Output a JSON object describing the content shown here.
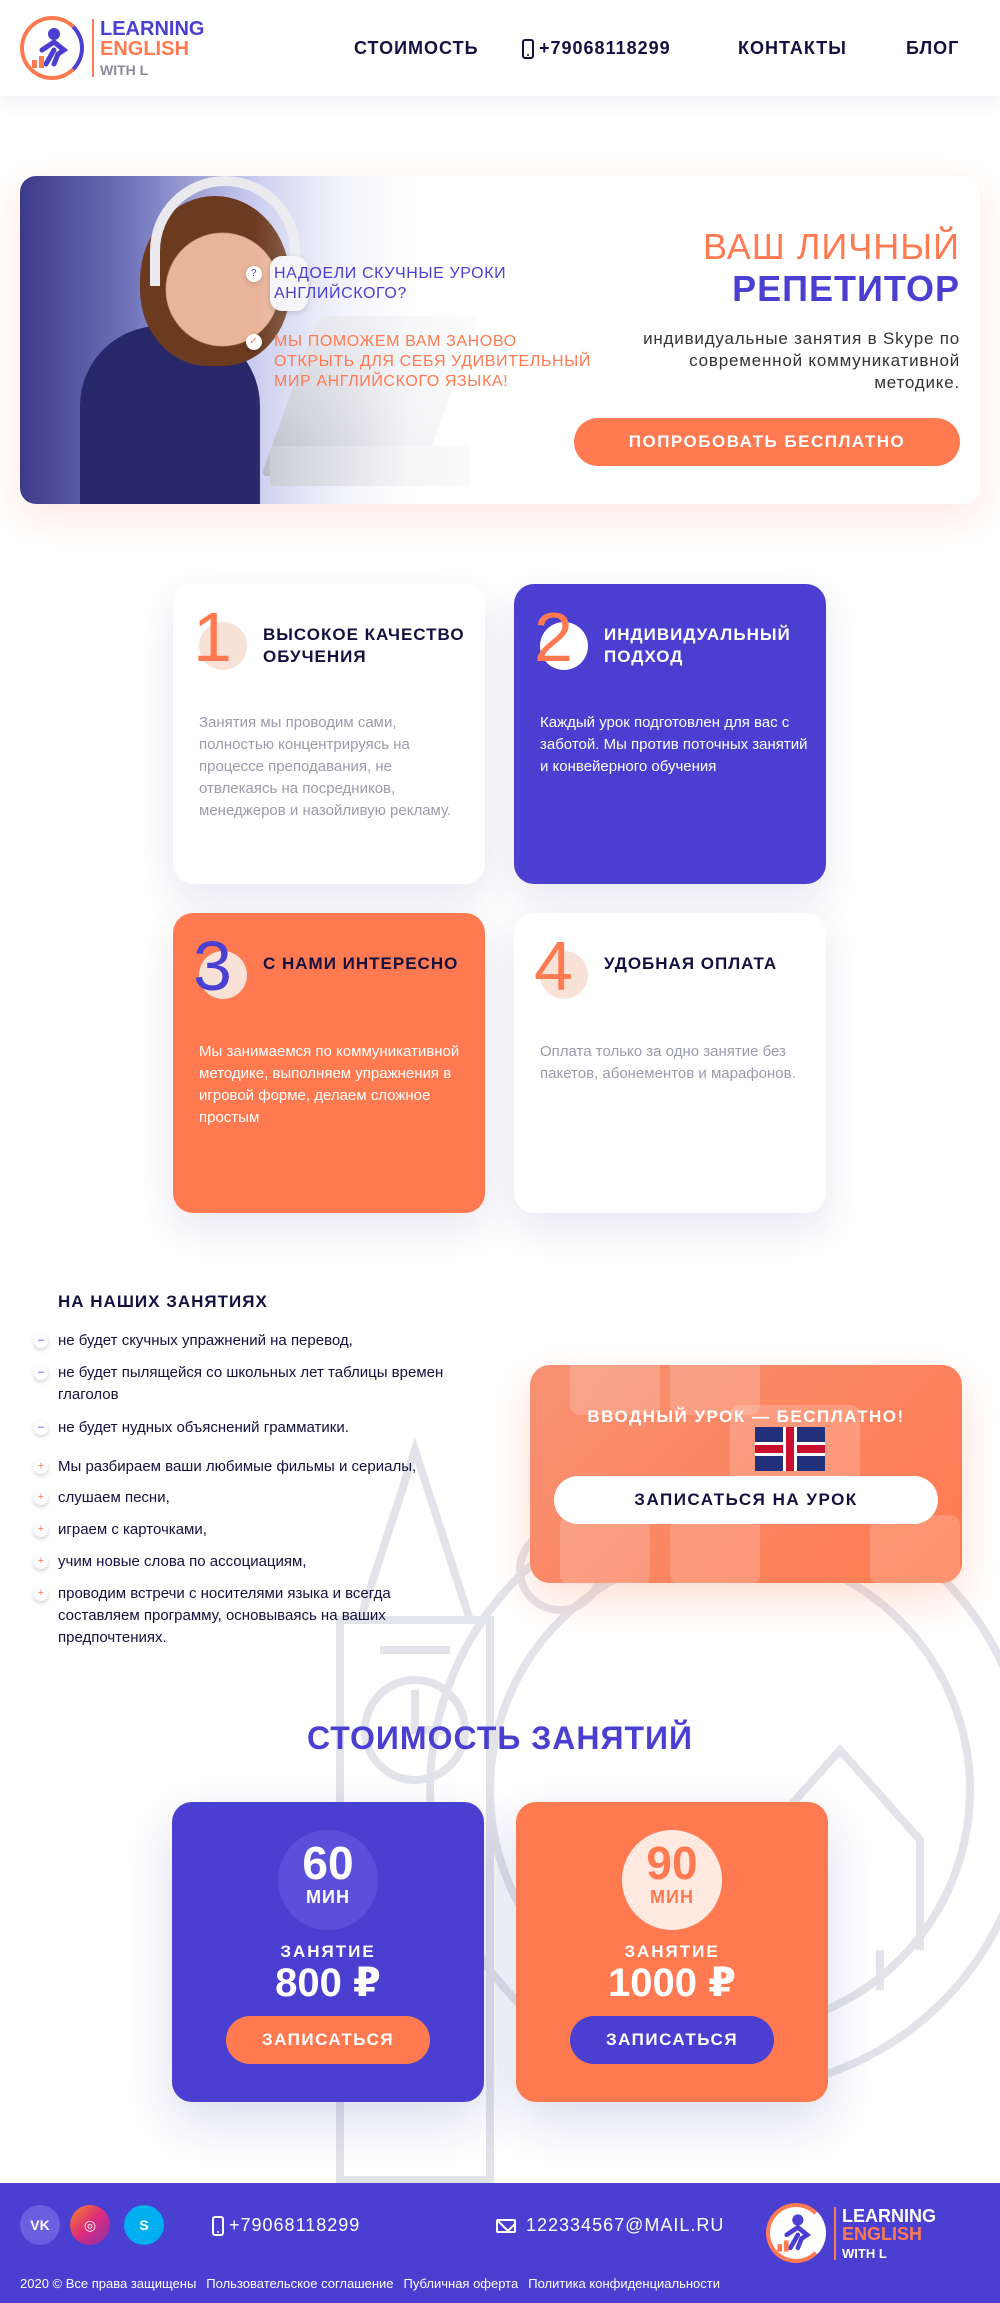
{
  "header": {
    "logo": {
      "line1": "LEARNING",
      "line2": "ENGLISH",
      "line3": "WITH L"
    },
    "nav": {
      "price": "СТОИМОСТЬ",
      "phone": "+79068118299",
      "contacts": "КОНТАКТЫ",
      "blog": "БЛОГ"
    }
  },
  "hero": {
    "question": "НАДОЕЛИ СКУЧНЫЕ УРОКИ АНГЛИЙСКОГО?",
    "answer": "МЫ ПОМОЖЕМ ВАМ ЗАНОВО ОТКРЫТЬ ДЛЯ СЕБЯ УДИВИТЕЛЬНЫЙ МИР АНГЛИЙСКОГО ЯЗЫКА!",
    "title_line1": "ВАШ ЛИЧНЫЙ",
    "title_line2": "РЕПЕТИТОР",
    "subtitle": "индивидуальные занятия в Skype по современной коммуникативной методике.",
    "button": "ПОПРОБОВАТЬ БЕСПЛАТНО"
  },
  "features": [
    {
      "num": "1",
      "title": "ВЫСОКОЕ КАЧЕСТВО ОБУЧЕНИЯ",
      "text": "Занятия мы проводим сами, полностью концентрируясь на процессе преподавания, не отвлекаясь на посредников, менеджеров и назойливую рекламу."
    },
    {
      "num": "2",
      "title": "ИНДИВИДУАЛЬНЫЙ ПОДХОД",
      "text": "Каждый урок подготовлен для вас с заботой. Мы против поточных занятий и конвейерного обучения"
    },
    {
      "num": "3",
      "title": "С НАМИ ИНТЕРЕСНО",
      "text": "Мы занимаемся по коммуникативной методике, выполняем упражнения в игровой форме, делаем сложное простым"
    },
    {
      "num": "4",
      "title": "УДОБНАЯ ОПЛАТА",
      "text": "Оплата только за одно занятие без пакетов, абонементов и марафонов."
    }
  ],
  "lessons": {
    "title": "НА НАШИХ ЗАНЯТИЯХ",
    "minus_marker": "–",
    "plus_marker": "+",
    "minus": [
      "не будет скучных упражнений на перевод,",
      "не будет пылящейся со школьных лет таблицы времен глаголов",
      "не будет нудных объяснений грамматики."
    ],
    "plus": [
      "Мы разбираем ваши любимые фильмы и сериалы,",
      "слушаем песни,",
      "играем с карточками,",
      "учим новые слова по ассоциациям,",
      "проводим встречи с носителями языка и всегда составляем программу, основываясь на ваших предпочтениях."
    ]
  },
  "promo": {
    "title": "ВВОДНЫЙ УРОК — БЕСПЛАТНО!",
    "button": "ЗАПИСАТЬСЯ  НА УРОК"
  },
  "pricing": {
    "title": "СТОИМОСТЬ ЗАНЯТИЙ",
    "plans": [
      {
        "minutes": "60",
        "unit": "МИН",
        "label": "ЗАНЯТИЕ",
        "price": "800 ₽",
        "button": "ЗАПИСАТЬСЯ"
      },
      {
        "minutes": "90",
        "unit": "МИН",
        "label": "ЗАНЯТИЕ",
        "price": "1000 ₽",
        "button": "ЗАПИСАТЬСЯ"
      }
    ]
  },
  "footer": {
    "phone": "+79068118299",
    "email": "122334567@MAIL.RU",
    "social": {
      "vk": "VK",
      "instagram": "◎",
      "skype": "S"
    },
    "copyright": "2020 © Все права защищены",
    "links": [
      "Пользовательское соглашение",
      "Публичная оферта",
      "Политика конфиденциальности"
    ]
  },
  "colors": {
    "brand_blue": "#4a3fd1",
    "brand_orange": "#ff7a50",
    "dark_text": "#141040"
  }
}
